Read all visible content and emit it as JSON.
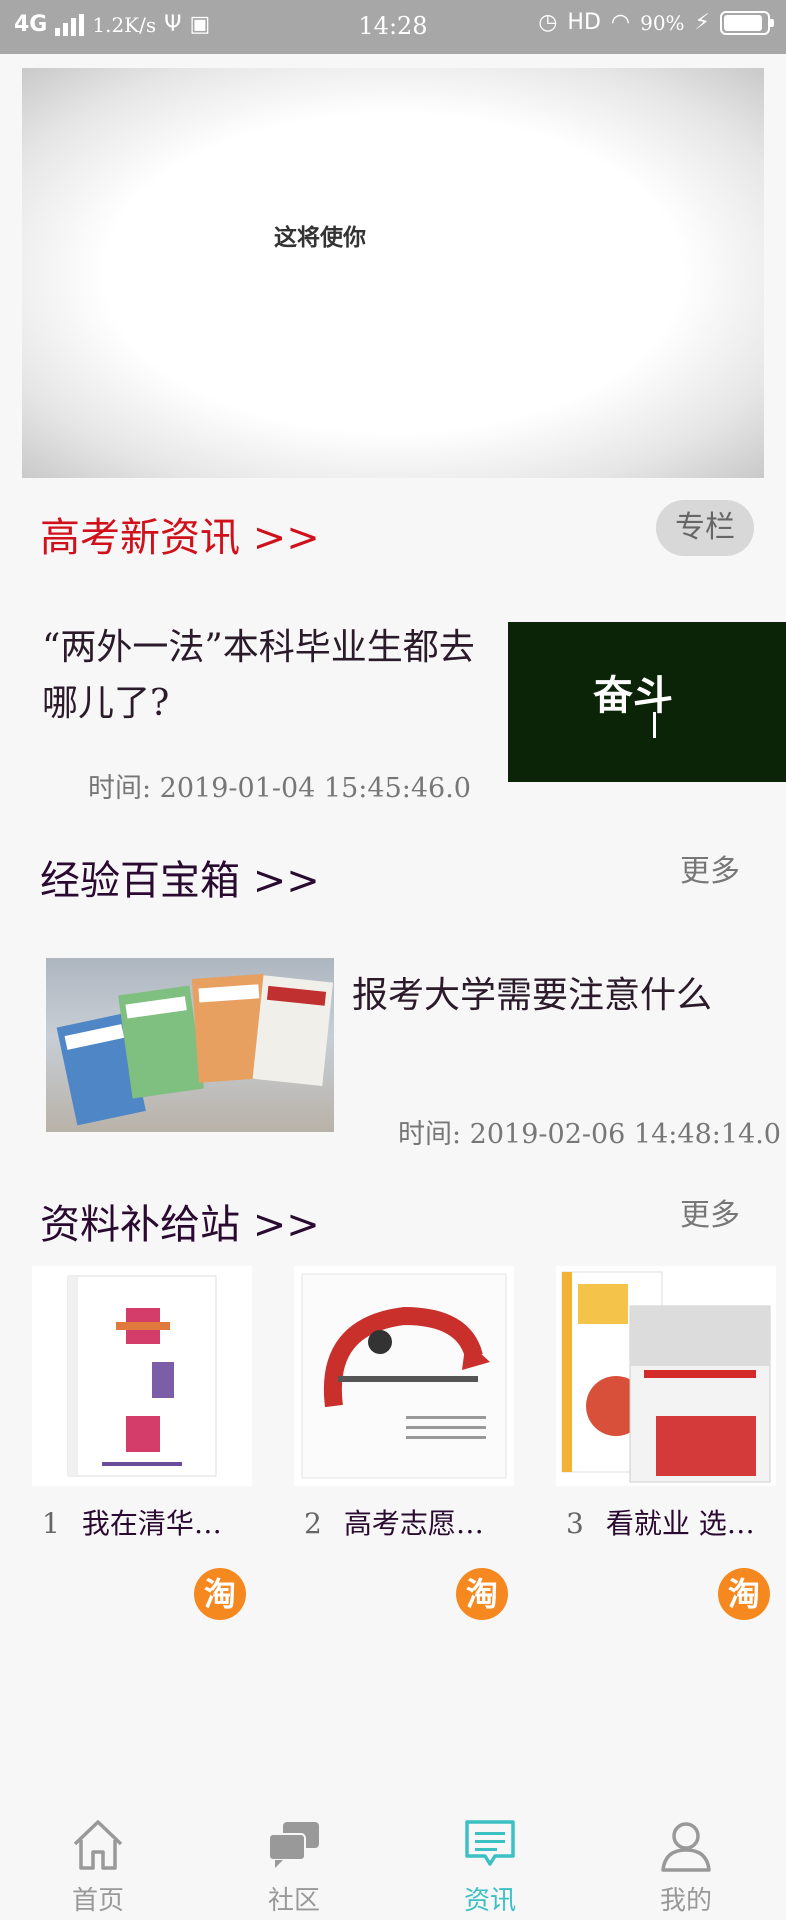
{
  "status_bar": {
    "network": "4G",
    "speed": "1.2K/s",
    "time": "14:28",
    "hd": "HD",
    "battery": "90%",
    "battery_level": 0.9
  },
  "banner": {
    "caption": "这将使你"
  },
  "news": {
    "section_title": "高考新资讯 >>",
    "column_button": "专栏",
    "item_title": "“两外一法”本科毕业生都去哪儿了?",
    "item_time": "时间:  2019-01-04 15:45:46.0",
    "thumb_text": "奋斗"
  },
  "experience": {
    "section_title": "经验百宝箱 >>",
    "more": "更多",
    "item_title": "报考大学需要注意什么",
    "item_time": "时间:  2019-02-06 14:48:14.0"
  },
  "supply": {
    "section_title": "资料补给站 >>",
    "more": "更多",
    "tao_icon": "淘",
    "books": [
      {
        "num": "1",
        "title": "我在清华…"
      },
      {
        "num": "2",
        "title": "高考志愿…"
      },
      {
        "num": "3",
        "title": "看就业 选…"
      }
    ]
  },
  "tab_bar": {
    "tabs": [
      {
        "label": "首页",
        "icon": "home-icon"
      },
      {
        "label": "社区",
        "icon": "community-icon"
      },
      {
        "label": "资讯",
        "icon": "news-icon"
      },
      {
        "label": "我的",
        "icon": "profile-icon"
      }
    ],
    "active_color": "#3cc0c4",
    "inactive_color": "#999999"
  }
}
